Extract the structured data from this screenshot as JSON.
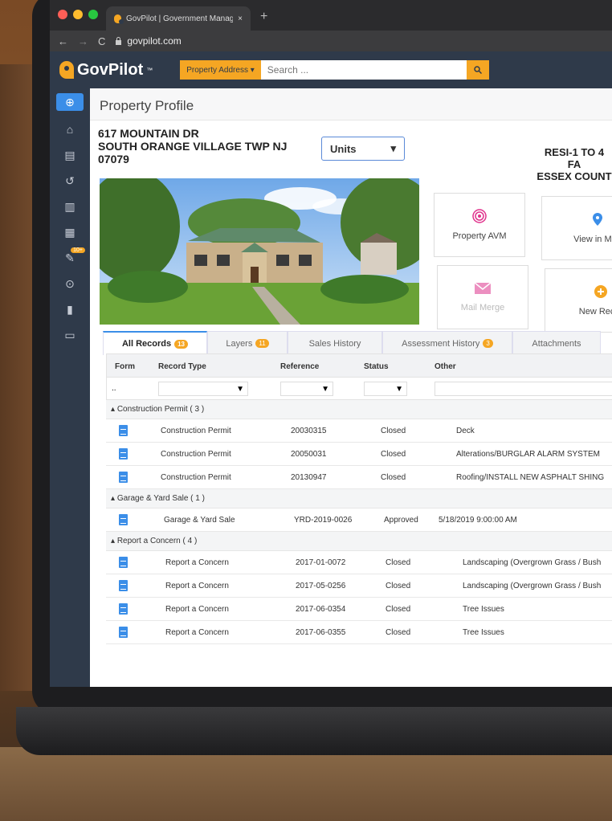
{
  "browser": {
    "tab_title": "GovPilot | Government Managem",
    "url": "govpilot.com",
    "new_tab": "+",
    "close_tab": "×",
    "nav_back": "←",
    "nav_forward": "→",
    "reload": "C"
  },
  "header": {
    "logo_text": "GovPilot",
    "logo_tm": "™",
    "search_type": "Property Address",
    "search_placeholder": "Search ..."
  },
  "sidebar": {
    "badge": "10+",
    "items": [
      "plus-icon",
      "home-icon",
      "document-icon",
      "history-icon",
      "map-icon",
      "calendar-icon",
      "edit-icon",
      "zoom-icon",
      "chart-icon",
      "folder-icon"
    ]
  },
  "page": {
    "title": "Property Profile",
    "address_line1": "617 MOUNTAIN DR",
    "address_line2": "SOUTH ORANGE VILLAGE TWP NJ",
    "address_line3": "07079",
    "units_label": "Units",
    "zoning_line1": "RESI-1 TO 4 FA",
    "zoning_line2": "ESSEX COUNT"
  },
  "tiles": {
    "avm": "Property AVM",
    "map": "View in Map",
    "mail": "Mail Merge",
    "new_record": "New Recor"
  },
  "record_tabs": [
    {
      "label": "All Records",
      "badge": "13"
    },
    {
      "label": "Layers",
      "badge": "11"
    },
    {
      "label": "Sales History",
      "badge": ""
    },
    {
      "label": "Assessment History",
      "badge": "3"
    },
    {
      "label": "Attachments",
      "badge": ""
    }
  ],
  "grid": {
    "columns": {
      "form": "Form",
      "record_type": "Record Type",
      "reference": "Reference",
      "status": "Status",
      "other": "Other"
    },
    "filter_dots": "..",
    "groups": [
      {
        "title": "Construction Permit ( 3 )",
        "rows": [
          {
            "type": "Construction Permit",
            "reference": "20030315",
            "status": "Closed",
            "other": "Deck"
          },
          {
            "type": "Construction Permit",
            "reference": "20050031",
            "status": "Closed",
            "other": "Alterations/BURGLAR ALARM SYSTEM"
          },
          {
            "type": "Construction Permit",
            "reference": "20130947",
            "status": "Closed",
            "other": "Roofing/INSTALL NEW ASPHALT SHING"
          }
        ]
      },
      {
        "title": "Garage & Yard Sale ( 1 )",
        "rows": [
          {
            "type": "Garage & Yard Sale",
            "reference": "YRD-2019-0026",
            "status": "Approved",
            "other": "5/18/2019 9:00:00 AM"
          }
        ]
      },
      {
        "title": "Report a Concern ( 4 )",
        "rows": [
          {
            "type": "Report a Concern",
            "reference": "2017-01-0072",
            "status": "Closed",
            "other": "Landscaping (Overgrown Grass / Bush"
          },
          {
            "type": "Report a Concern",
            "reference": "2017-05-0256",
            "status": "Closed",
            "other": "Landscaping (Overgrown Grass / Bush"
          },
          {
            "type": "Report a Concern",
            "reference": "2017-06-0354",
            "status": "Closed",
            "other": "Tree Issues"
          },
          {
            "type": "Report a Concern",
            "reference": "2017-06-0355",
            "status": "Closed",
            "other": "Tree Issues"
          }
        ]
      }
    ]
  },
  "colors": {
    "accent_orange": "#f5a623",
    "nav_dark": "#2f3a4a",
    "accent_blue": "#3b8ee8",
    "avm_pink": "#e0328c",
    "mail_pink": "#ec8fc0"
  }
}
